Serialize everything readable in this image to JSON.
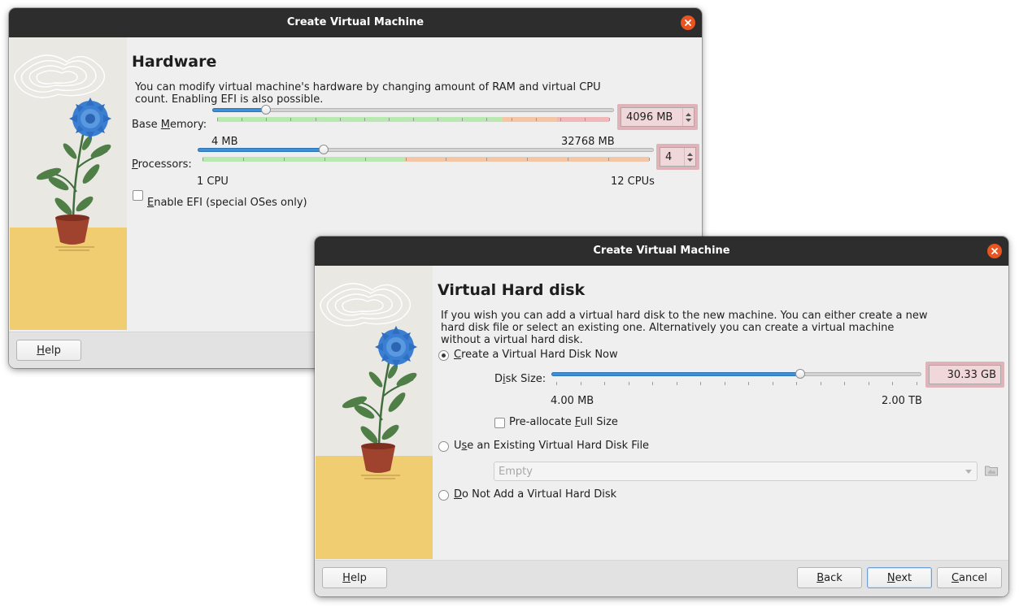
{
  "window1": {
    "title": "Create Virtual Machine",
    "heading": "Hardware",
    "description_line1": "You can modify virtual machine's hardware by changing amount of RAM and virtual CPU",
    "description_line2": "count. Enabling EFI is also possible.",
    "base_memory": {
      "label_prefix": "Base ",
      "label_mnemonic": "M",
      "label_suffix": "emory:",
      "min_label": "4 MB",
      "max_label": "32768 MB",
      "value": "4096 MB",
      "slider_fraction": 0.125
    },
    "processors": {
      "label_mnemonic": "P",
      "label_suffix": "rocessors:",
      "min_label": "1 CPU",
      "max_label": "12 CPUs",
      "value": "4",
      "slider_fraction": 0.2727
    },
    "efi": {
      "label_mnemonic": "E",
      "label_suffix": "nable EFI (special OSes only)",
      "checked": false
    },
    "buttons": {
      "help_mnemonic": "H",
      "help_suffix": "elp"
    }
  },
  "window2": {
    "title": "Create Virtual Machine",
    "heading": "Virtual Hard disk",
    "description_line1": "If you wish you can add a virtual hard disk to the new machine. You can either create a new",
    "description_line2": "hard disk file or select an existing one. Alternatively you can create a virtual machine",
    "description_line3": "without a virtual hard disk.",
    "options": {
      "create_mnemonic": "C",
      "create_suffix": "reate a Virtual Hard Disk Now",
      "existing_prefix": "U",
      "existing_mnemonic": "s",
      "existing_suffix": "e an Existing Virtual Hard Disk File",
      "none_mnemonic": "D",
      "none_suffix": "o Not Add a Virtual Hard Disk",
      "selected": "create"
    },
    "disk_size": {
      "label_prefix": "D",
      "label_mnemonic": "i",
      "label_suffix": "sk Size:",
      "min_label": "4.00 MB",
      "max_label": "2.00 TB",
      "value": "30.33 GB",
      "slider_fraction": 0.675
    },
    "preallocate": {
      "label_prefix": "Pre-allocate ",
      "label_mnemonic": "F",
      "label_suffix": "ull Size",
      "checked": false
    },
    "existing_file_combo": {
      "value": "Empty"
    },
    "buttons": {
      "help_mnemonic": "H",
      "help_suffix": "elp",
      "back_mnemonic": "B",
      "back_suffix": "ack",
      "next_mnemonic": "N",
      "next_suffix": "ext",
      "cancel_mnemonic": "C",
      "cancel_suffix": "ancel"
    }
  },
  "colors": {
    "titlebar": "#2d2d2d",
    "close_button": "#e95420",
    "slider_fill": "#3e8fd6",
    "zone_green": "#b9e8b0",
    "zone_orange": "#f4c6a8",
    "zone_red": "#f0b8b8",
    "spin_highlight": "#f0d8da"
  },
  "icons": [
    "close-icon",
    "spin-up-icon",
    "spin-down-icon",
    "folder-icon",
    "combo-arrow-icon"
  ]
}
